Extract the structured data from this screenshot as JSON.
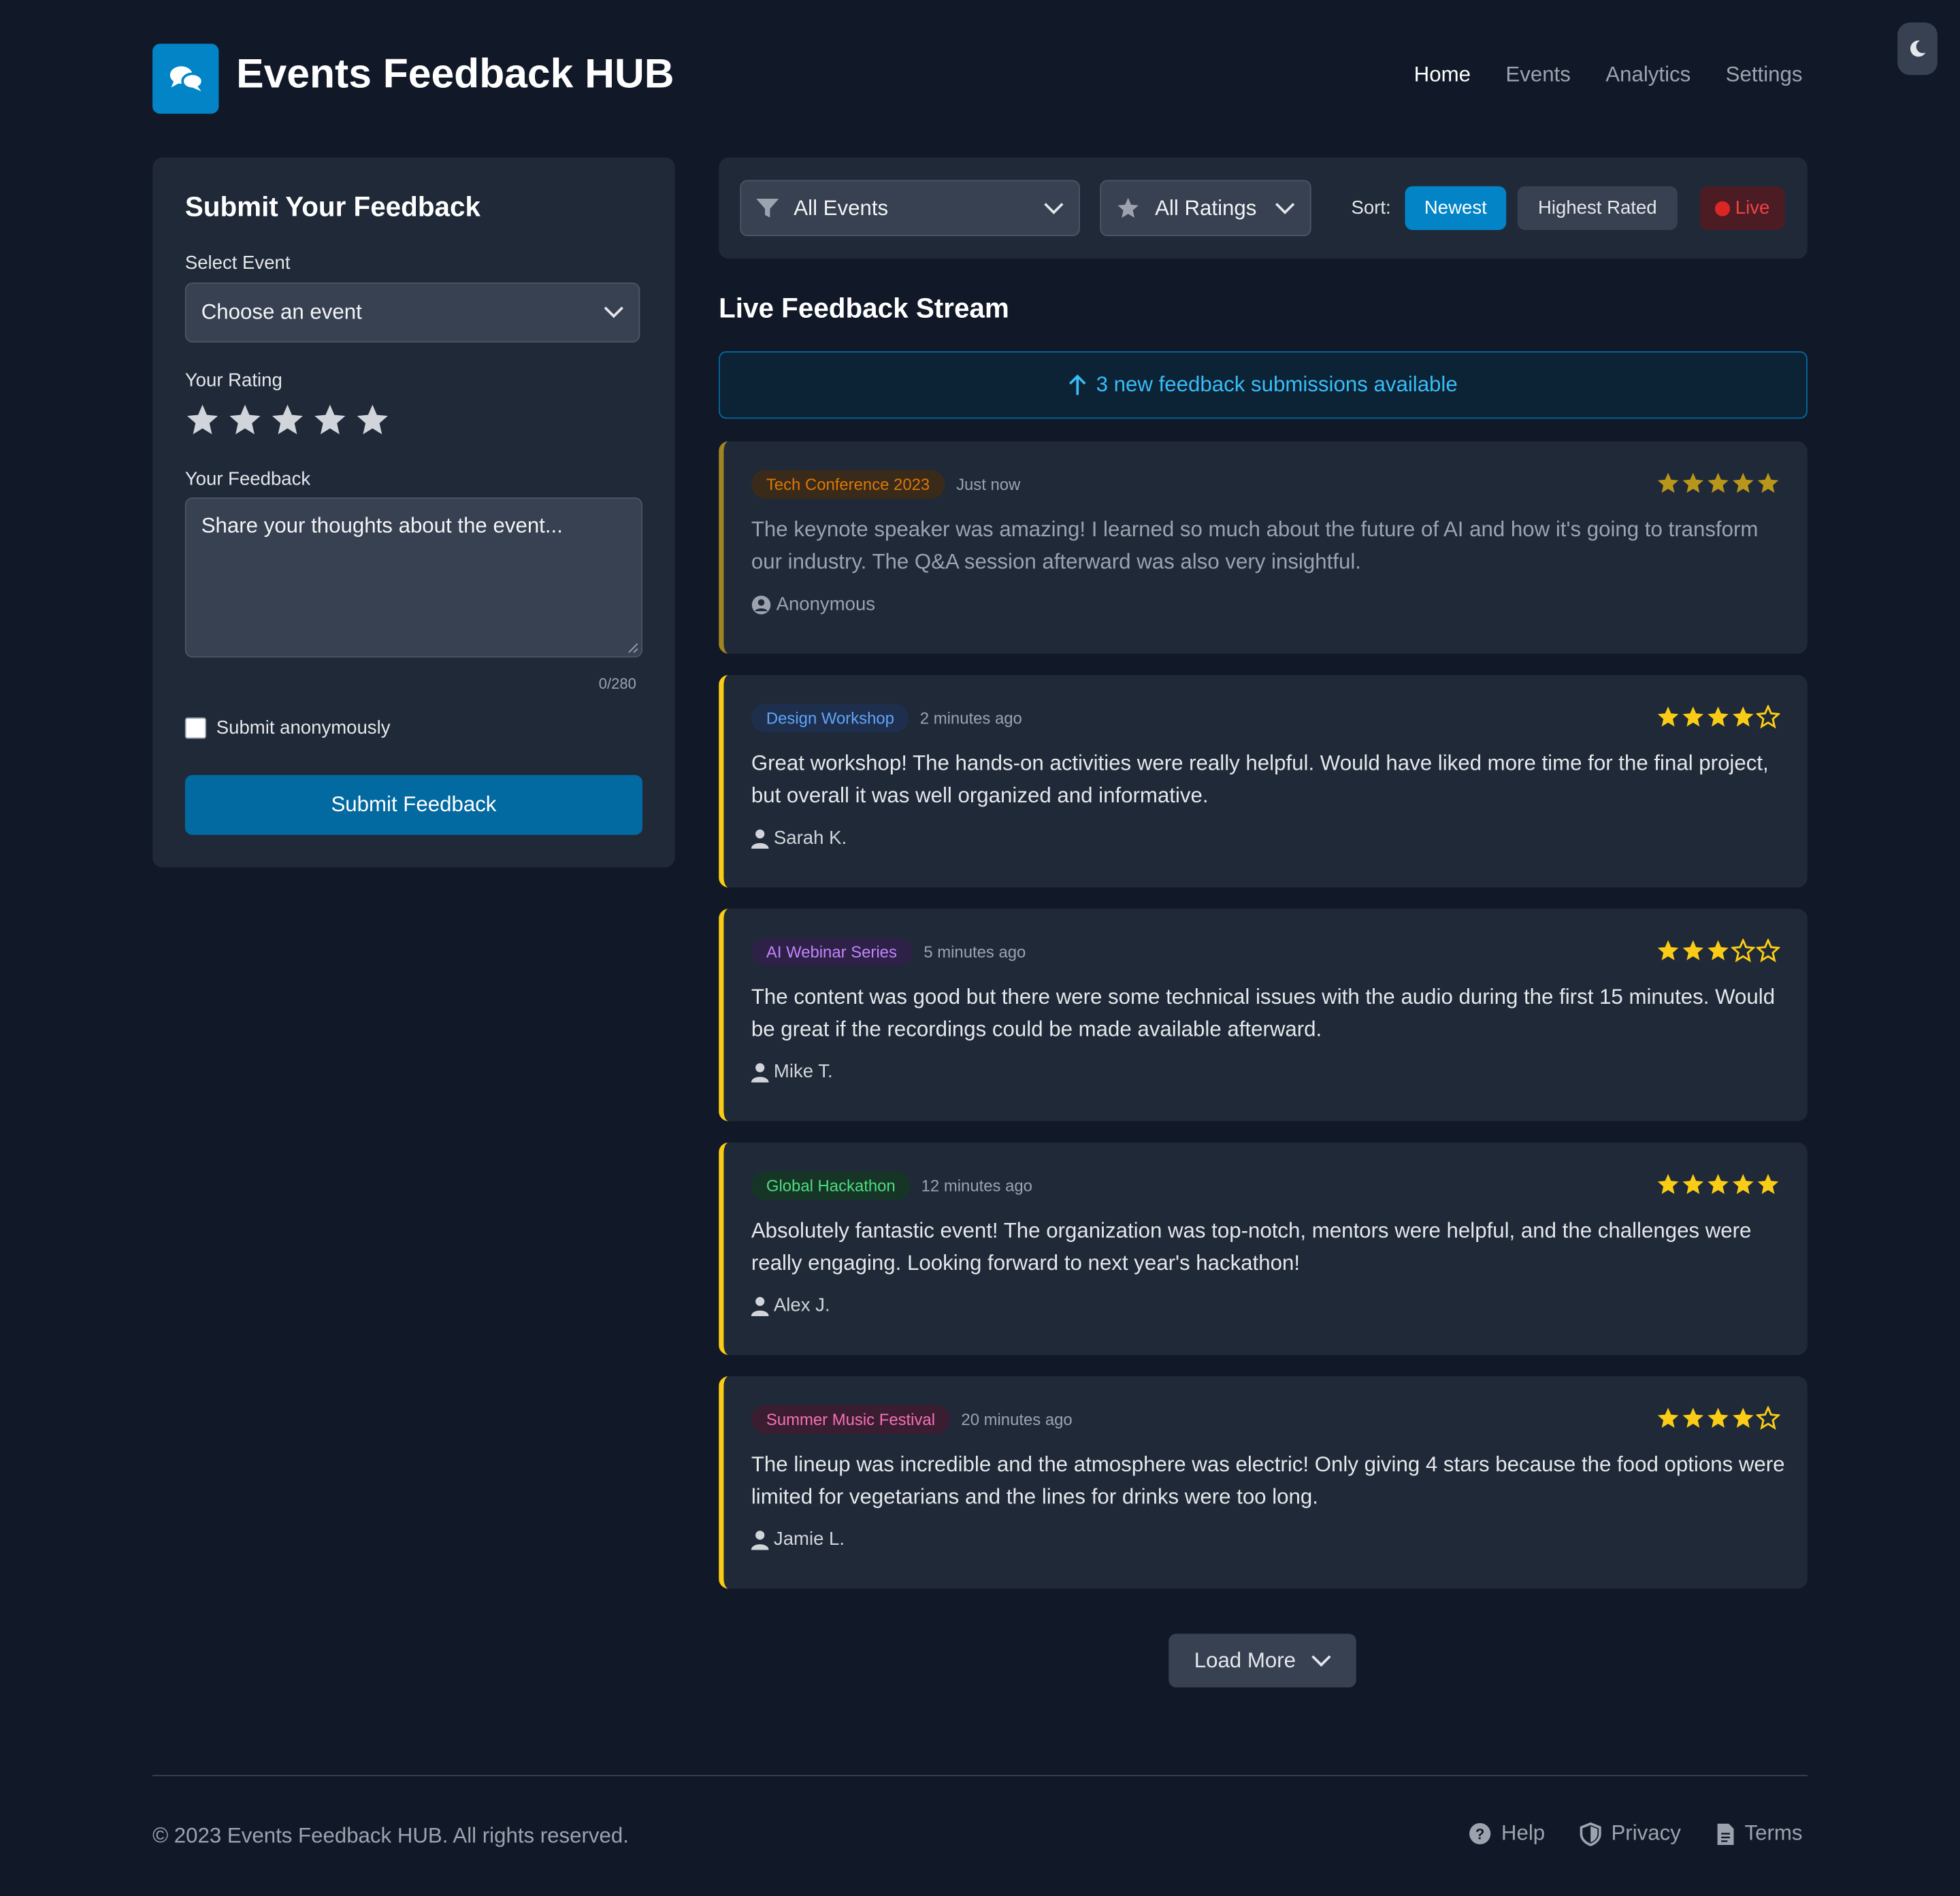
{
  "app": {
    "title": "Events Feedback HUB"
  },
  "nav": {
    "items": [
      "Home",
      "Events",
      "Analytics",
      "Settings"
    ],
    "active": "Home"
  },
  "form": {
    "title": "Submit Your Feedback",
    "event_label": "Select Event",
    "event_value": "Choose an event",
    "rating_label": "Your Rating",
    "rating_value": 0,
    "rating_max": 5,
    "feedback_label": "Your Feedback",
    "feedback_placeholder": "Share your thoughts about the event...",
    "char_count": "0/280",
    "anonymous_label": "Submit anonymously",
    "anonymous_checked": false,
    "submit_label": "Submit Feedback"
  },
  "filters": {
    "event_filter": "All Events",
    "rating_filter": "All Ratings",
    "sort_label": "Sort:",
    "sort_newest": "Newest",
    "sort_highest": "Highest Rated",
    "sort_active": "Newest",
    "live_label": "Live"
  },
  "stream": {
    "title": "Live Feedback Stream",
    "new_banner": "3 new feedback submissions available",
    "load_more": "Load More"
  },
  "feedback": [
    {
      "event": "Tech Conference 2023",
      "time": "Just now",
      "rating": 5,
      "text": "The keynote speaker was amazing! I learned so much about the future of AI and how it's going to transform our industry. The Q&A session afterward was also very insightful.",
      "author": "Anonymous",
      "tag_color": "#d97706",
      "tag_bg": "#3a2a1a"
    },
    {
      "event": "Design Workshop",
      "time": "2 minutes ago",
      "rating": 4,
      "text": "Great workshop! The hands-on activities were really helpful. Would have liked more time for the final project, but overall it was well organized and informative.",
      "author": "Sarah K.",
      "tag_color": "#60a5fa",
      "tag_bg": "#1e2f4d"
    },
    {
      "event": "AI Webinar Series",
      "time": "5 minutes ago",
      "rating": 3,
      "text": "The content was good but there were some technical issues with the audio during the first 15 minutes. Would be great if the recordings could be made available afterward.",
      "author": "Mike T.",
      "tag_color": "#c084fc",
      "tag_bg": "#2e2147"
    },
    {
      "event": "Global Hackathon",
      "time": "12 minutes ago",
      "rating": 5,
      "text": "Absolutely fantastic event! The organization was top-notch, mentors were helpful, and the challenges were really engaging. Looking forward to next year's hackathon!",
      "author": "Alex J.",
      "tag_color": "#4ade80",
      "tag_bg": "#173526"
    },
    {
      "event": "Summer Music Festival",
      "time": "20 minutes ago",
      "rating": 4,
      "text": "The lineup was incredible and the atmosphere was electric! Only giving 4 stars because the food options were limited for vegetarians and the lines for drinks were too long.",
      "author": "Jamie L.",
      "tag_color": "#f472b6",
      "tag_bg": "#3a1d31"
    }
  ],
  "footer": {
    "copyright": "© 2023 Events Feedback HUB. All rights reserved.",
    "links": [
      {
        "label": "Help",
        "icon": "help-icon"
      },
      {
        "label": "Privacy",
        "icon": "shield-icon"
      },
      {
        "label": "Terms",
        "icon": "document-icon"
      }
    ]
  },
  "colors": {
    "accent": "#0284c7",
    "star": "#facc15",
    "live": "#ef4444"
  }
}
